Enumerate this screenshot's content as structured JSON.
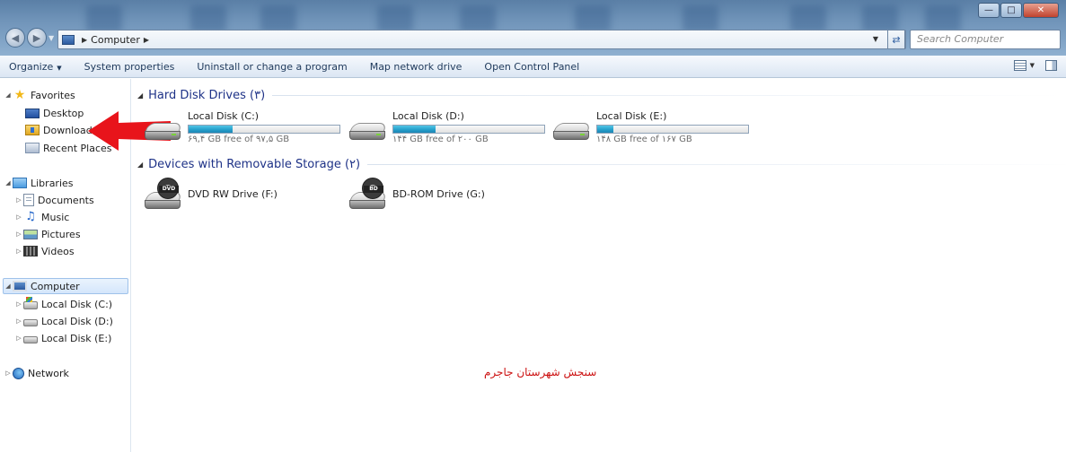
{
  "address": {
    "path": "Computer",
    "search_placeholder": "Search Computer"
  },
  "toolbar": {
    "organize": "Organize",
    "system_properties": "System properties",
    "uninstall": "Uninstall or change a program",
    "map_drive": "Map network drive",
    "control_panel": "Open Control Panel"
  },
  "nav": {
    "favorites": "Favorites",
    "desktop": "Desktop",
    "downloads": "Downloads",
    "recent_places": "Recent Places",
    "libraries": "Libraries",
    "documents": "Documents",
    "music": "Music",
    "pictures": "Pictures",
    "videos": "Videos",
    "computer": "Computer",
    "disk_c": "Local Disk (C:)",
    "disk_d": "Local Disk (D:)",
    "disk_e": "Local Disk (E:)",
    "network": "Network"
  },
  "groups": {
    "hdd": "Hard Disk Drives (٣)",
    "removable": "Devices with Removable Storage (٢)"
  },
  "drives": [
    {
      "name": "Local Disk (C:)",
      "free_text": "۶۹,۴ GB free of ۹۷,۵ GB",
      "used_fraction": 0.29
    },
    {
      "name": "Local Disk (D:)",
      "free_text": "۱۴۴ GB free of ۲۰۰ GB",
      "used_fraction": 0.28
    },
    {
      "name": "Local Disk (E:)",
      "free_text": "۱۴۸ GB free of ۱۶۷ GB",
      "used_fraction": 0.11
    }
  ],
  "optical": [
    {
      "name": "DVD RW Drive (F:)",
      "badge": "DVD"
    },
    {
      "name": "BD-ROM Drive (G:)",
      "badge": "BD"
    }
  ],
  "watermark": "سنجش شهرستان جاجرم",
  "colors": {
    "arrow": "#e8141b",
    "watermark": "#cc1111",
    "capacity_fill": "#26a0cc"
  }
}
